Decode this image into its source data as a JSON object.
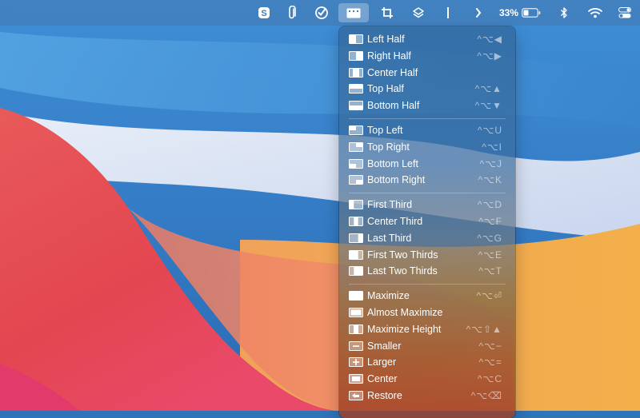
{
  "menubar": {
    "battery_percent": "33%",
    "icons": [
      "skype-icon",
      "paperclip-icon",
      "checkmark-circle-icon",
      "rectangle-app-icon",
      "crop-icon",
      "layers-icon",
      "text-cursor-icon",
      "chevron-right-icon",
      "battery-icon",
      "bluetooth-icon",
      "wifi-icon",
      "control-center-icon"
    ]
  },
  "menu": {
    "groups": [
      [
        {
          "label": "Left Half",
          "shortcut": "^⌥◀",
          "icon": "left-half-icon"
        },
        {
          "label": "Right Half",
          "shortcut": "^⌥▶",
          "icon": "right-half-icon"
        },
        {
          "label": "Center Half",
          "shortcut": "",
          "icon": "center-half-icon"
        },
        {
          "label": "Top Half",
          "shortcut": "^⌥▲",
          "icon": "top-half-icon"
        },
        {
          "label": "Bottom Half",
          "shortcut": "^⌥▼",
          "icon": "bottom-half-icon"
        }
      ],
      [
        {
          "label": "Top Left",
          "shortcut": "^⌥U",
          "icon": "top-left-icon"
        },
        {
          "label": "Top Right",
          "shortcut": "^⌥I",
          "icon": "top-right-icon"
        },
        {
          "label": "Bottom Left",
          "shortcut": "^⌥J",
          "icon": "bottom-left-icon"
        },
        {
          "label": "Bottom Right",
          "shortcut": "^⌥K",
          "icon": "bottom-right-icon"
        }
      ],
      [
        {
          "label": "First Third",
          "shortcut": "^⌥D",
          "icon": "first-third-icon"
        },
        {
          "label": "Center Third",
          "shortcut": "^⌥F",
          "icon": "center-third-icon"
        },
        {
          "label": "Last Third",
          "shortcut": "^⌥G",
          "icon": "last-third-icon"
        },
        {
          "label": "First Two Thirds",
          "shortcut": "^⌥E",
          "icon": "first-two-thirds-icon"
        },
        {
          "label": "Last Two Thirds",
          "shortcut": "^⌥T",
          "icon": "last-two-thirds-icon"
        }
      ],
      [
        {
          "label": "Maximize",
          "shortcut": "^⌥⏎",
          "icon": "maximize-icon"
        },
        {
          "label": "Almost Maximize",
          "shortcut": "",
          "icon": "almost-maximize-icon"
        },
        {
          "label": "Maximize Height",
          "shortcut": "^⌥⇧▲",
          "icon": "maximize-height-icon"
        },
        {
          "label": "Smaller",
          "shortcut": "^⌥−",
          "icon": "smaller-icon"
        },
        {
          "label": "Larger",
          "shortcut": "^⌥=",
          "icon": "larger-icon"
        },
        {
          "label": "Center",
          "shortcut": "^⌥C",
          "icon": "center-icon"
        },
        {
          "label": "Restore",
          "shortcut": "^⌥⌫",
          "icon": "restore-icon"
        }
      ]
    ]
  }
}
